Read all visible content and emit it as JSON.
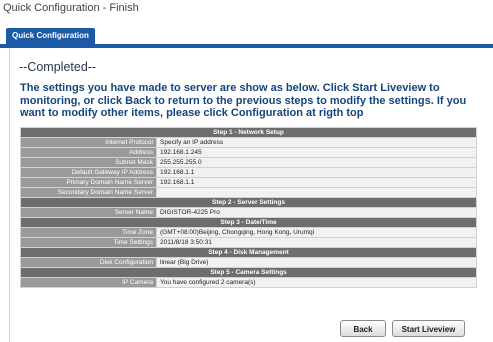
{
  "page": {
    "title": "Quick Configuration - Finish"
  },
  "tabs": [
    {
      "label": "Quick Configuration"
    }
  ],
  "content": {
    "completed": "--Completed--",
    "message": "The settings you have made to server are show as below. Click Start Liveview to monitoring, or click Back to return to the previous steps to modify the settings. If you want to modify other items, please click Configuration at rigth top"
  },
  "summary": {
    "step1": {
      "title": "Step 1 - Network Setup",
      "rows": [
        {
          "label": "Internet Protocol",
          "value": "Specify an IP address"
        },
        {
          "label": "Address",
          "value": "192.168.1.245"
        },
        {
          "label": "Subnet Mask",
          "value": "255.255.255.0"
        },
        {
          "label": "Default Gateway IP Address",
          "value": "192.168.1.1"
        },
        {
          "label": "Primary Domain Name Server",
          "value": "192.168.1.1"
        },
        {
          "label": "Secondary Domain Name Server",
          "value": ""
        }
      ]
    },
    "step2": {
      "title": "Step 2 - Server Settings",
      "rows": [
        {
          "label": "Server Name",
          "value": "DIGISTOR-4225 Pro"
        }
      ]
    },
    "step3": {
      "title": "Step 3 - Date/Time",
      "rows": [
        {
          "label": "Time Zone",
          "value": "(GMT+08:00)Beijing, Chongqing, Hong Kong, Urumqi"
        },
        {
          "label": "Time Settings",
          "value": "2011/8/18 3:50:31"
        }
      ]
    },
    "step4": {
      "title": "Step 4 - Disk Management",
      "rows": [
        {
          "label": "Disk Configuration",
          "value": "linear (Big Drive)"
        }
      ]
    },
    "step5": {
      "title": "Step 5 - Camera Settings",
      "rows": [
        {
          "label": "IP Camera",
          "value": "You have configured 2 camera(s)"
        }
      ]
    }
  },
  "buttons": {
    "back": "Back",
    "start_liveview": "Start Liveview"
  },
  "colors": {
    "accent": "#1c5aa5",
    "heading": "#15457f",
    "section": "#6d6d6d",
    "label": "#9a9a9a"
  }
}
